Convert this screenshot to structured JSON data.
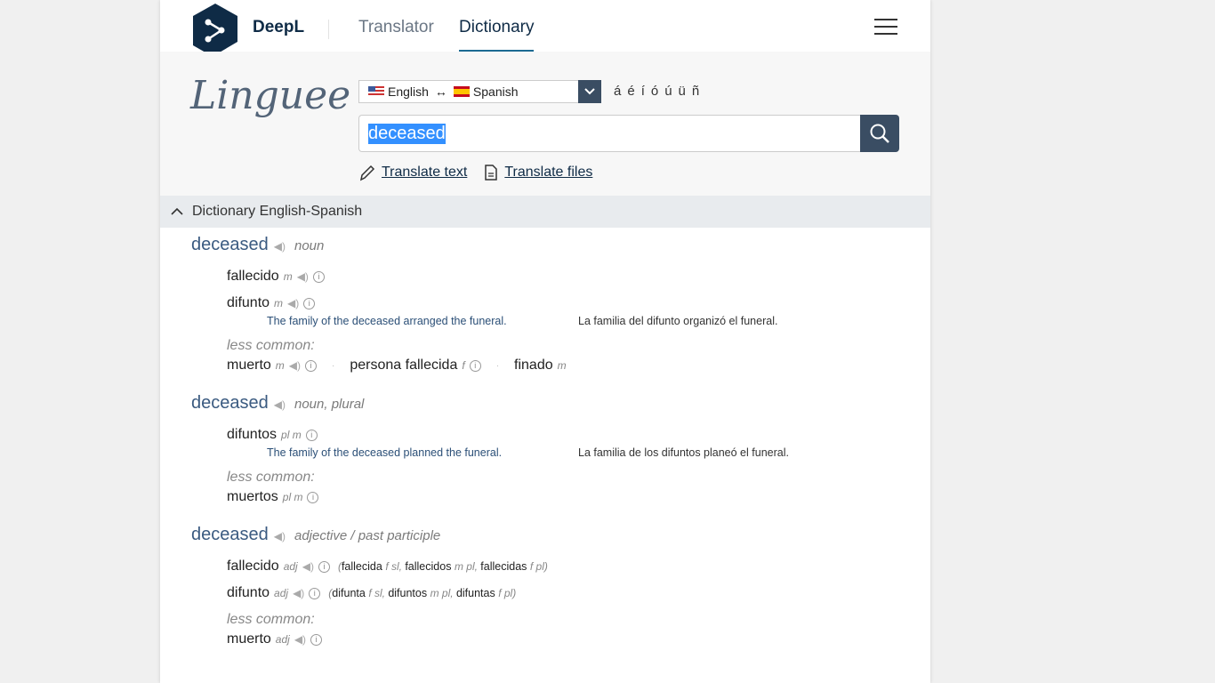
{
  "header": {
    "brand": "DeepL",
    "nav": [
      {
        "label": "Translator",
        "active": false
      },
      {
        "label": "Dictionary",
        "active": true
      }
    ]
  },
  "search": {
    "logo": "Linguee",
    "lang_from": "English",
    "lang_to": "Spanish",
    "special_chars": [
      "á",
      "é",
      "í",
      "ó",
      "ú",
      "ü",
      "ñ"
    ],
    "query": "deceased",
    "translate_text": "Translate text",
    "translate_files": "Translate files"
  },
  "section_title": "Dictionary English-Spanish",
  "colors": {
    "accent": "#1c6a92",
    "dark": "#3a4d63",
    "headword": "#3a5a80"
  },
  "entries": [
    {
      "headword": "deceased",
      "pos": "noun",
      "translations": [
        {
          "word": "fallecido",
          "gram": "m",
          "example": null
        },
        {
          "word": "difunto",
          "gram": "m",
          "example": {
            "en": "The family of the deceased arranged the funeral.",
            "es": "La familia del difunto organizó el funeral."
          }
        }
      ],
      "less_common_label": "less common:",
      "less_common": [
        {
          "word": "muerto",
          "gram": "m",
          "audio": true,
          "info": true
        },
        {
          "word": "persona fallecida",
          "gram": "f",
          "audio": false,
          "info": true
        },
        {
          "word": "finado",
          "gram": "m",
          "audio": false,
          "info": false
        }
      ]
    },
    {
      "headword": "deceased",
      "pos": "noun, plural",
      "translations": [
        {
          "word": "difuntos",
          "gram": "pl m",
          "noaudio": true,
          "example": {
            "en": "The family of the deceased planned the funeral.",
            "es": "La familia de los difuntos planeó el funeral."
          }
        }
      ],
      "less_common_label": "less common:",
      "less_common": [
        {
          "word": "muertos",
          "gram": "pl m",
          "audio": false,
          "info": true
        }
      ]
    },
    {
      "headword": "deceased",
      "pos": "adjective / past participle",
      "translations": [
        {
          "word": "fallecido",
          "gram": "adj",
          "inflections": [
            [
              "fallecida",
              "f sl"
            ],
            [
              "fallecidos",
              "m pl"
            ],
            [
              "fallecidas",
              "f pl"
            ]
          ]
        },
        {
          "word": "difunto",
          "gram": "adj",
          "inflections": [
            [
              "difunta",
              "f sl"
            ],
            [
              "difuntos",
              "m pl"
            ],
            [
              "difuntas",
              "f pl"
            ]
          ]
        }
      ],
      "less_common_label": "less common:",
      "less_common": [
        {
          "word": "muerto",
          "gram": "adj",
          "audio": true,
          "info": true
        }
      ]
    }
  ]
}
